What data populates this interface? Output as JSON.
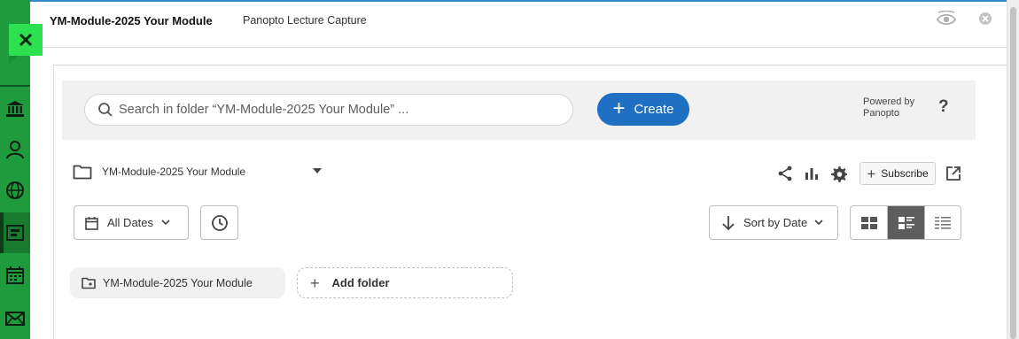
{
  "topbar": {
    "title": "YM-Module-2025 Your Module",
    "tool_name": "Panopto Lecture Capture"
  },
  "sidebar": {
    "items": [
      {
        "icon": "institution-icon"
      },
      {
        "icon": "person-icon"
      },
      {
        "icon": "globe-icon"
      },
      {
        "icon": "courses-icon"
      },
      {
        "icon": "calendar-icon"
      },
      {
        "icon": "mail-icon"
      }
    ]
  },
  "search": {
    "placeholder": "Search in folder “YM-Module-2025 Your Module” ..."
  },
  "create": {
    "label": "Create"
  },
  "powered": {
    "line1": "Powered by",
    "line2": "Panopto"
  },
  "help": {
    "label": "?"
  },
  "folder": {
    "name": "YM-Module-2025 Your Module"
  },
  "toolbar": {
    "subscribe_label": "Subscribe"
  },
  "filters": {
    "dates_label": "All Dates",
    "sort_label": "Sort by Date"
  },
  "view_switcher": {
    "active": "detail"
  },
  "folders": [
    {
      "name": "YM-Module-2025 Your Module"
    }
  ],
  "add_folder": {
    "label": "Add folder"
  },
  "colors": {
    "sidebar_green": "#1f9a3c",
    "close_green": "#2de04f",
    "create_blue": "#1f6fc3"
  }
}
